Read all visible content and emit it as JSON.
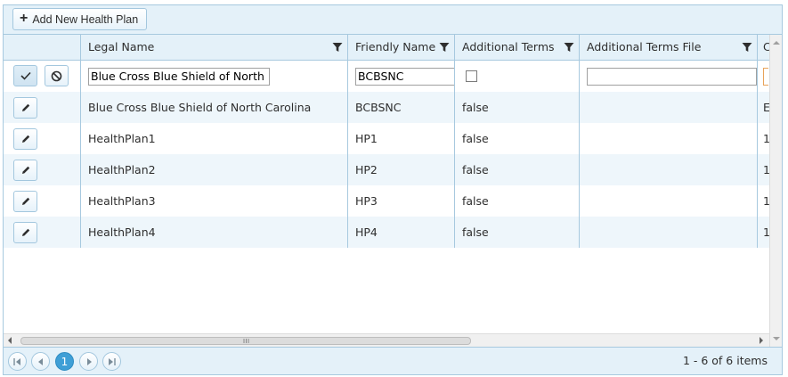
{
  "toolbar": {
    "add_label": "Add New Health Plan"
  },
  "columns": [
    {
      "label": "Legal Name"
    },
    {
      "label": "Friendly Name"
    },
    {
      "label": "Additional Terms"
    },
    {
      "label": "Additional Terms File"
    },
    {
      "label": "C"
    }
  ],
  "edit_row": {
    "legal_name": "Blue Cross Blue Shield of North C",
    "friendly_name": "BCBSNC",
    "additional_terms_checked": false,
    "additional_terms_file": ""
  },
  "rows": [
    {
      "legal_name": "Blue Cross Blue Shield of North Carolina",
      "friendly_name": "BCBSNC",
      "additional_terms": "false",
      "additional_terms_file": "",
      "next": "E"
    },
    {
      "legal_name": "HealthPlan1",
      "friendly_name": "HP1",
      "additional_terms": "false",
      "additional_terms_file": "",
      "next": "1"
    },
    {
      "legal_name": "HealthPlan2",
      "friendly_name": "HP2",
      "additional_terms": "false",
      "additional_terms_file": "",
      "next": "1"
    },
    {
      "legal_name": "HealthPlan3",
      "friendly_name": "HP3",
      "additional_terms": "false",
      "additional_terms_file": "",
      "next": "1"
    },
    {
      "legal_name": "HealthPlan4",
      "friendly_name": "HP4",
      "additional_terms": "false",
      "additional_terms_file": "",
      "next": "1"
    }
  ],
  "pager": {
    "current_page": "1",
    "info": "1 - 6 of 6 items"
  },
  "colors": {
    "accent": "#3f9fd6",
    "header_bg": "#e4f1f9",
    "border": "#a7c9df",
    "alt_row": "#eef6fb"
  },
  "icons": [
    "plus-icon",
    "filter-icon",
    "check-icon",
    "cancel-icon",
    "pencil-icon",
    "first-page-icon",
    "prev-page-icon",
    "next-page-icon",
    "last-page-icon"
  ]
}
